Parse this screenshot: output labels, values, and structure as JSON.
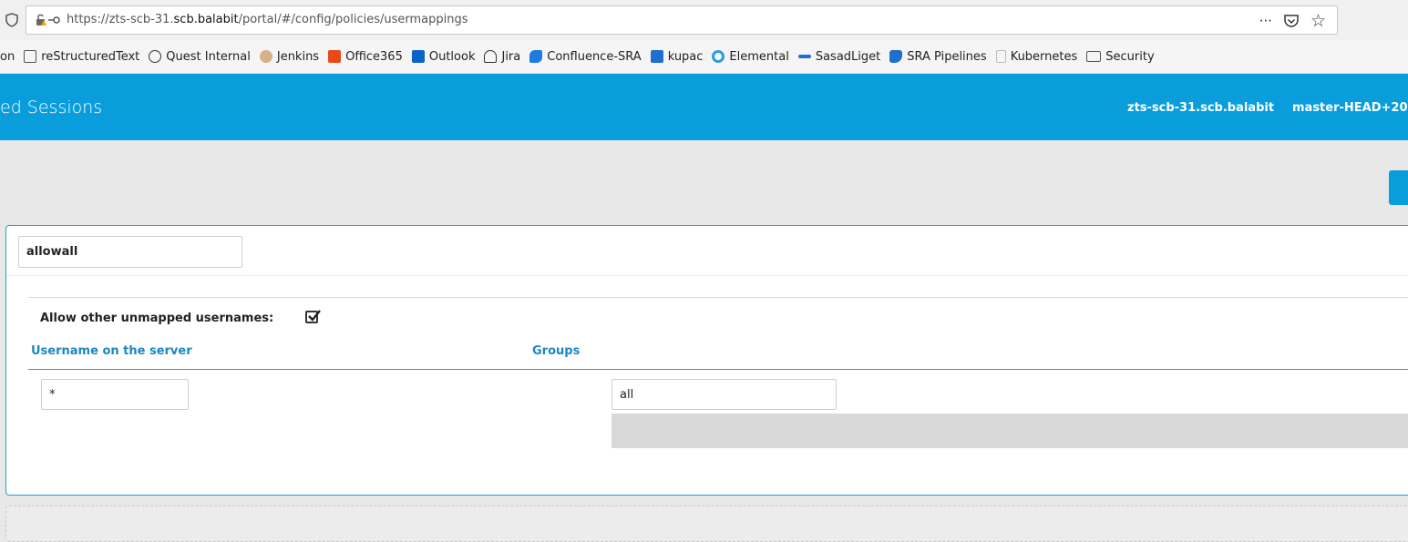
{
  "browser": {
    "url_prefix": "https://zts-scb-31.",
    "url_domain": "scb.balabit",
    "url_suffix": "/portal/#/config/policies/usermappings",
    "more_label": "···",
    "pocket_label": "☐",
    "star_label": "☆"
  },
  "bookmarks": [
    {
      "label": "on",
      "icon": "bookmark-fragment-icon",
      "color": "#f5f5f5"
    },
    {
      "label": "reStructuredText",
      "icon": "rst-icon",
      "color": "#555555"
    },
    {
      "label": "Quest Internal",
      "icon": "globe-icon",
      "color": "#333333"
    },
    {
      "label": "Jenkins",
      "icon": "jenkins-icon",
      "color": "#c9a07a"
    },
    {
      "label": "Office365",
      "icon": "office-icon",
      "color": "#e64a19"
    },
    {
      "label": "Outlook",
      "icon": "outlook-icon",
      "color": "#0a64c8"
    },
    {
      "label": "Jira",
      "icon": "jira-icon",
      "color": "#333333"
    },
    {
      "label": "Confluence-SRA",
      "icon": "confluence-icon",
      "color": "#1e7be0"
    },
    {
      "label": "kupac",
      "icon": "dsm-icon",
      "color": "#1e6fd0"
    },
    {
      "label": "Elemental",
      "icon": "elemental-icon",
      "color": "#2a9de0"
    },
    {
      "label": "SasadLiget",
      "icon": "commit-icon",
      "color": "#1e6fd0"
    },
    {
      "label": "SRA Pipelines",
      "icon": "pipelines-icon",
      "color": "#1e6fd0"
    },
    {
      "label": "Kubernetes",
      "icon": "page-icon",
      "color": "#bbbbbb"
    },
    {
      "label": "Security",
      "icon": "folder-icon",
      "color": "#555555"
    }
  ],
  "header": {
    "title": "ed Sessions",
    "hostname": "zts-scb-31.scb.balabit",
    "build": "master-HEAD+20",
    "accent_color": "#0a9ddc"
  },
  "policy": {
    "name": "allowall",
    "allow_unmapped_label": "Allow other unmapped usernames:",
    "allow_unmapped_checked": true,
    "col_username": "Username on the server",
    "col_groups": "Groups",
    "rows": [
      {
        "username": "*",
        "group": "all"
      }
    ]
  }
}
